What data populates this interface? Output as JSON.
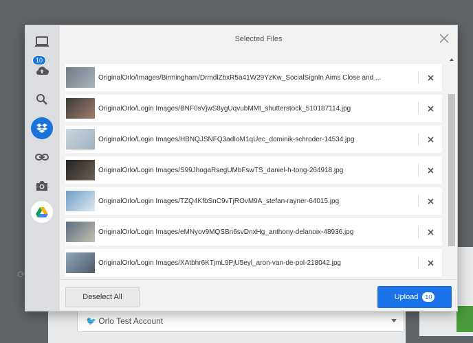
{
  "background": {
    "account_select": "Orlo Test Account"
  },
  "modal": {
    "title": "Selected Files",
    "sidebar": {
      "items": [
        {
          "icon": "laptop-icon"
        },
        {
          "icon": "cloud-upload-icon",
          "badge": "10"
        },
        {
          "icon": "search-icon"
        },
        {
          "icon": "dropbox-icon",
          "active": true
        },
        {
          "icon": "link-icon"
        },
        {
          "icon": "camera-icon"
        },
        {
          "icon": "google-drive-icon"
        }
      ]
    },
    "files": [
      {
        "name": "OriginalOrlo/Images/Birmingham/DrmdlZbxR5a41W29YzKw_SocialSignIn Aims Close and ...",
        "thumb": [
          "#6f7a84",
          "#aab4bd"
        ]
      },
      {
        "name": "OriginalOrlo/Login Images/BNF0sVjwS8ygUqvubMMt_shutterstock_510187114.jpg",
        "thumb": [
          "#3b3a3c",
          "#a27f6a"
        ]
      },
      {
        "name": "OriginalOrlo/Login Images/HBNQJSNFQ3adIoM1qUec_dominik-schroder-14534.jpg",
        "thumb": [
          "#c9d6df",
          "#9fb1bd"
        ]
      },
      {
        "name": "OriginalOrlo/Login Images/S99JhogaRsegUMbFswTS_daniel-h-tong-264918.jpg",
        "thumb": [
          "#222",
          "#6e6255"
        ]
      },
      {
        "name": "OriginalOrlo/Login Images/TZQ4KfbSnC9vTjROvM9A_stefan-rayner-64015.jpg",
        "thumb": [
          "#6c9ec7",
          "#dfe9f1"
        ]
      },
      {
        "name": "OriginalOrlo/Login Images/eMNyov9MQSBn6svDnxHg_anthony-delanoix-48936.jpg",
        "thumb": [
          "#5a6d80",
          "#c6c0b0"
        ]
      },
      {
        "name": "OriginalOrlo/Login Images/XAtbhr6KTjmL9PjU5eyl_aron-van-de-pol-218042.jpg",
        "thumb": [
          "#8fa7bd",
          "#4e5b67"
        ]
      }
    ],
    "footer": {
      "deselect_label": "Deselect All",
      "upload_label": "Upload",
      "upload_count": "10"
    }
  },
  "colors": {
    "accent": "#1a73e8"
  }
}
